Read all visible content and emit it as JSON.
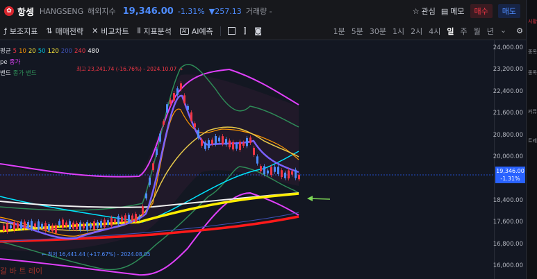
{
  "header": {
    "symbol_name": "항셍",
    "symbol_code": "HANGSENG",
    "market": "해외지수",
    "price": "19,346.00",
    "pct_change": "-1.31%",
    "abs_change": "▼257.13",
    "volume_label": "거래량 -",
    "watch_label": "관심",
    "memo_label": "메모",
    "buy_label": "매수",
    "sell_label": "매도"
  },
  "toolbar": {
    "indicators": "보조지표",
    "strategy": "매매전략",
    "compare": "비교차트",
    "analysis": "지표분석",
    "ai": "AI예측",
    "ai_badge": "AI",
    "intervals": [
      "1분",
      "5분",
      "30분",
      "1시",
      "2시",
      "4시",
      "일",
      "주",
      "월",
      "년"
    ],
    "active_interval": "일"
  },
  "legend": {
    "ma_label": "평균",
    "ma_periods": [
      {
        "p": "5",
        "color": "#f23645"
      },
      {
        "p": "10",
        "color": "#ff9800"
      },
      {
        "p": "20",
        "color": "#ffeb3b"
      },
      {
        "p": "50",
        "color": "#00bcd4"
      },
      {
        "p": "120",
        "color": "#ffeb3b"
      },
      {
        "p": "200",
        "color": "#3f51b5"
      },
      {
        "p": "240",
        "color": "#f23645"
      },
      {
        "p": "480",
        "color": "#ffffff"
      }
    ],
    "row2_label": "pe",
    "row2_value": "종가",
    "row3_label": "밴드",
    "row3_value": "종가 밴드"
  },
  "annotations": {
    "high": "최고 23,241.74 (-16.76%) - 2024.10.07 →",
    "low": "← 최저 16,441.44 (+17.67%) - 2024.08.05",
    "bottom_text": "갈 바 트 레이"
  },
  "price_axis": {
    "ticks": [
      "24,000.00",
      "23,200.00",
      "22,400.00",
      "21,600.00",
      "20,800.00",
      "20,000.00",
      "18,400.00",
      "17,600.00",
      "16,800.00",
      "16,000.00"
    ],
    "current_price": "19,346.00",
    "current_pct": "-1.31%"
  },
  "sidebar": {
    "items": [
      "시황",
      "종목",
      "종목",
      "커뮤",
      "트레"
    ]
  },
  "colors": {
    "down": "#4e8cff",
    "up": "#f23645",
    "background": "#131722"
  },
  "chart_data": {
    "type": "candlestick",
    "y_range": [
      16000,
      24000
    ],
    "last_close": 19346,
    "high": 23241.74,
    "low": 16441.44
  }
}
